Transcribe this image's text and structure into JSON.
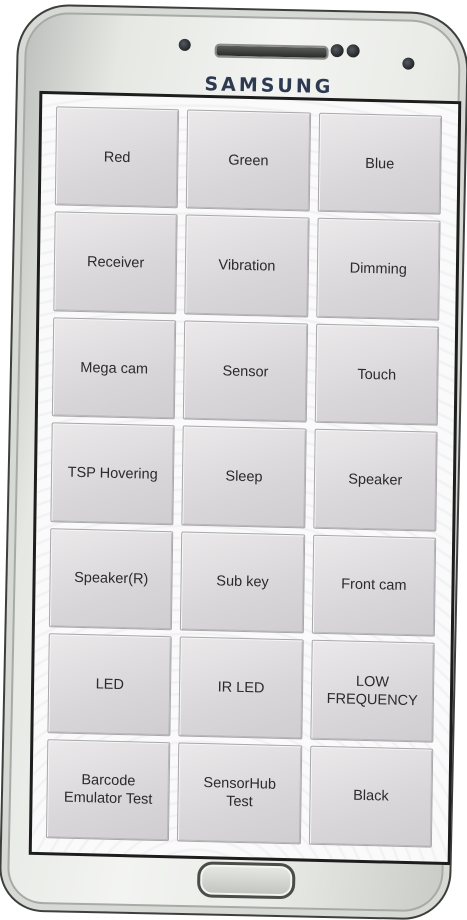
{
  "device": {
    "brand": "SAMSUNG"
  },
  "test_menu": {
    "buttons": [
      "Red",
      "Green",
      "Blue",
      "Receiver",
      "Vibration",
      "Dimming",
      "Mega cam",
      "Sensor",
      "Touch",
      "TSP Hovering",
      "Sleep",
      "Speaker",
      "Speaker(R)",
      "Sub key",
      "Front cam",
      "LED",
      "IR LED",
      "LOW\nFREQUENCY",
      "Barcode\nEmulator Test",
      "SensorHub\nTest",
      "Black"
    ]
  }
}
